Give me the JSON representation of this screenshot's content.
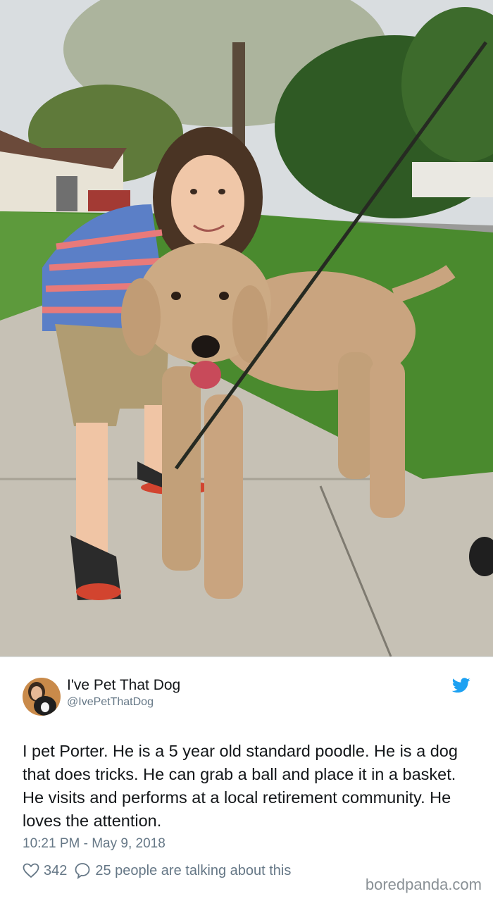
{
  "tweet": {
    "author_name": "I've Pet That Dog",
    "author_handle": "@IvePetThatDog",
    "text": "I pet Porter. He is a 5 year old standard poodle. He is a dog that does tricks. He can grab a ball and place it in a basket. He visits and performs at a local retirement community. He loves the attention.",
    "timestamp": "10:21 PM - May 9, 2018",
    "likes": "342",
    "replies_text": "25 people are talking about this"
  },
  "watermark": "boredpanda.com",
  "colors": {
    "twitter_blue": "#1da1f2",
    "secondary_text": "#657786",
    "primary_text": "#14171a"
  },
  "icons": {
    "brand": "twitter-bird-icon",
    "like": "heart-icon",
    "reply": "speech-bubble-icon"
  }
}
